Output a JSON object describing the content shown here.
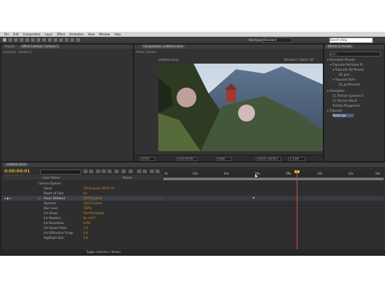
{
  "app": {
    "menu": [
      "File",
      "Edit",
      "Composition",
      "Layer",
      "Effect",
      "Animation",
      "View",
      "Window",
      "Help"
    ],
    "workspace_label": "Workspace:",
    "workspace_value": "Standard",
    "search_help_placeholder": "Search Help"
  },
  "project_panel": {
    "tab_project": "Project",
    "tab_effect_controls": "Effect Controls: Camera 1",
    "subhead": "unlocked · Camera 1"
  },
  "comp_panel": {
    "tab": "Composition: untitled scene",
    "subhead": "Active Camera",
    "sublabel_left": "untitled scene",
    "renderer": "Renderer: Classic 3D",
    "zoom": "(50%)",
    "timecode": "0:00:00:00",
    "resolution": "(Half)",
    "camera_view": "Active Camera",
    "views": "1 View"
  },
  "effects_panel": {
    "tab": "Effects & Presets",
    "search_value": "part",
    "items": [
      {
        "label": "▾ Animation Presets",
        "selected": false
      },
      {
        "label": "▾ Trapcode Particular Pr…",
        "selected": false
      },
      {
        "label": "▾ Trapcode 3D Presets",
        "selected": false
      },
      {
        "label": "3D_part…",
        "selected": false
      },
      {
        "label": "▾ Trapcode form",
        "selected": false
      },
      {
        "label": "3D_partPresets",
        "selected": false
      },
      {
        "label": "▾ Simulation",
        "selected": false
      },
      {
        "label": "CC Particle Systems II",
        "selected": false
      },
      {
        "label": "CC Particle World",
        "selected": false
      },
      {
        "label": "Particle Playground",
        "selected": false
      },
      {
        "label": "▾ Trapcode",
        "selected": false
      },
      {
        "label": "Particular",
        "selected": true
      }
    ]
  },
  "timeline": {
    "tab": "untitled scene",
    "current_time": "0:00:04:01",
    "current_time_sub": "00101 (24.00 fps)",
    "col_layer_name": "Layer Name",
    "col_parent": "Parent",
    "ruler_labels": [
      "0s",
      "02s",
      "04s",
      "06s",
      "08s",
      "10s",
      "12s",
      "14s"
    ],
    "properties": [
      {
        "name": "Camera Options",
        "value": ""
      },
      {
        "name": "Zoom",
        "value": "555.6 pixels (50.0° H)"
      },
      {
        "name": "Depth of Field",
        "value": "On"
      },
      {
        "name": "Focus Distance",
        "value": "3235.6 pixels",
        "highlight": true
      },
      {
        "name": "Aperture",
        "value": "1245.4 pixels"
      },
      {
        "name": "Blur Level",
        "value": "100%"
      },
      {
        "name": "Iris Shape",
        "value": "Fast Rectangle"
      },
      {
        "name": "Iris Rotation",
        "value": "0x +0.0°"
      },
      {
        "name": "Iris Roundness",
        "value": "0.0%"
      },
      {
        "name": "Iris Aspect Ratio",
        "value": "1.0"
      },
      {
        "name": "Iris Diffraction Fringe",
        "value": "0.0"
      },
      {
        "name": "Highlight Gain",
        "value": "0.0"
      }
    ],
    "status_toggle": "Toggle Switches / Modes"
  }
}
